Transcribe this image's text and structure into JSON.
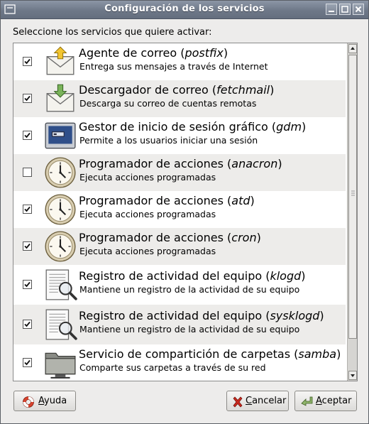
{
  "window": {
    "title": "Configuración de los servicios"
  },
  "prompt": "Seleccione los servicios que quiere activar:",
  "services": [
    {
      "checked": true,
      "icon": "mail-send-icon",
      "name_prefix": "Agente de correo (",
      "name_em": "postfix",
      "name_suffix": ")",
      "desc": "Entrega sus mensajes a través de Internet"
    },
    {
      "checked": true,
      "icon": "mail-download-icon",
      "name_prefix": "Descargador de correo (",
      "name_em": "fetchmail",
      "name_suffix": ")",
      "desc": "Descarga su correo de cuentas remotas"
    },
    {
      "checked": true,
      "icon": "login-screen-icon",
      "name_prefix": "Gestor de inicio de sesión gráfico (",
      "name_em": "gdm",
      "name_suffix": ")",
      "desc": "Permite a los usuarios iniciar una sesión"
    },
    {
      "checked": false,
      "icon": "clock-icon",
      "name_prefix": "Programador de acciones (",
      "name_em": "anacron",
      "name_suffix": ")",
      "desc": "Ejecuta acciones programadas"
    },
    {
      "checked": true,
      "icon": "clock-icon",
      "name_prefix": "Programador de acciones (",
      "name_em": "atd",
      "name_suffix": ")",
      "desc": "Ejecuta acciones programadas"
    },
    {
      "checked": true,
      "icon": "clock-icon",
      "name_prefix": "Programador de acciones (",
      "name_em": "cron",
      "name_suffix": ")",
      "desc": "Ejecuta acciones programadas"
    },
    {
      "checked": true,
      "icon": "log-viewer-icon",
      "name_prefix": "Registro de actividad del equipo (",
      "name_em": "klogd",
      "name_suffix": ")",
      "desc": "Mantiene un registro de la actividad de su equipo"
    },
    {
      "checked": true,
      "icon": "log-viewer-icon",
      "name_prefix": "Registro de actividad del equipo (",
      "name_em": "sysklogd",
      "name_suffix": ")",
      "desc": "Mantiene un registro de la actividad de su equipo"
    },
    {
      "checked": true,
      "icon": "shared-folder-icon",
      "name_prefix": "Servicio de compartición de carpetas (",
      "name_em": "samba",
      "name_suffix": ")",
      "desc": "Comparte sus carpetas a través de su red"
    }
  ],
  "buttons": {
    "help": {
      "mnemonic": "A",
      "rest": "yuda"
    },
    "cancel": {
      "mnemonic": "C",
      "rest": "ancelar"
    },
    "accept": {
      "mnemonic": "A",
      "rest": "ceptar"
    }
  }
}
